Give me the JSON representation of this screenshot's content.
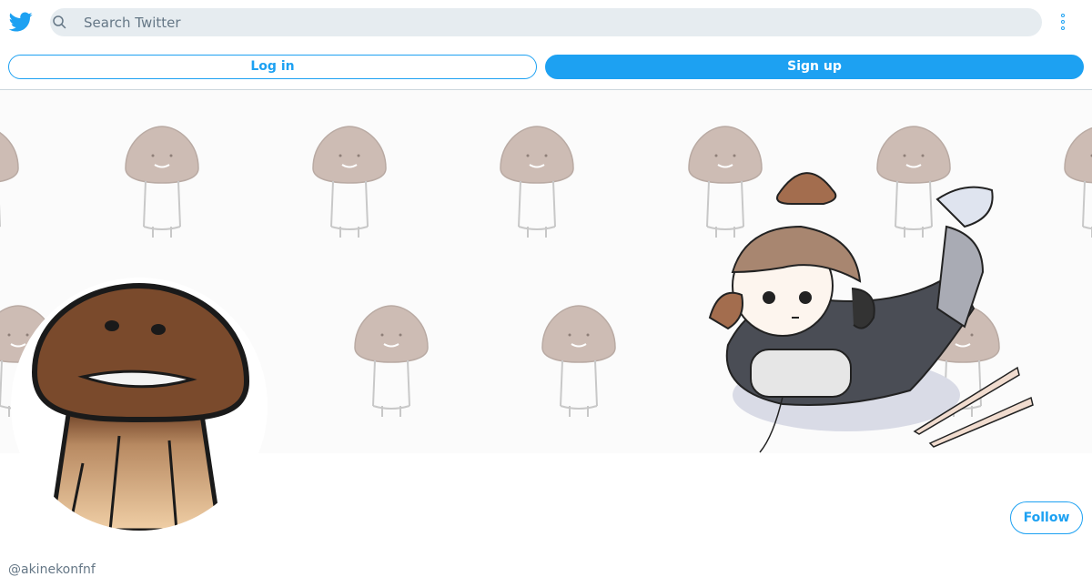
{
  "header": {
    "logo_icon": "twitter-bird-icon",
    "search_placeholder": "Search Twitter",
    "more_icon": "vertical-dots-icon",
    "accent_color": "#1da1f2"
  },
  "auth": {
    "login_label": "Log in",
    "signup_label": "Sign up"
  },
  "profile": {
    "banner_image": "mushroom-pattern-with-gamer-character",
    "avatar_image": "brown-mushroom-character",
    "follow_label": "Follow",
    "handle": "@akinekonfnf"
  }
}
